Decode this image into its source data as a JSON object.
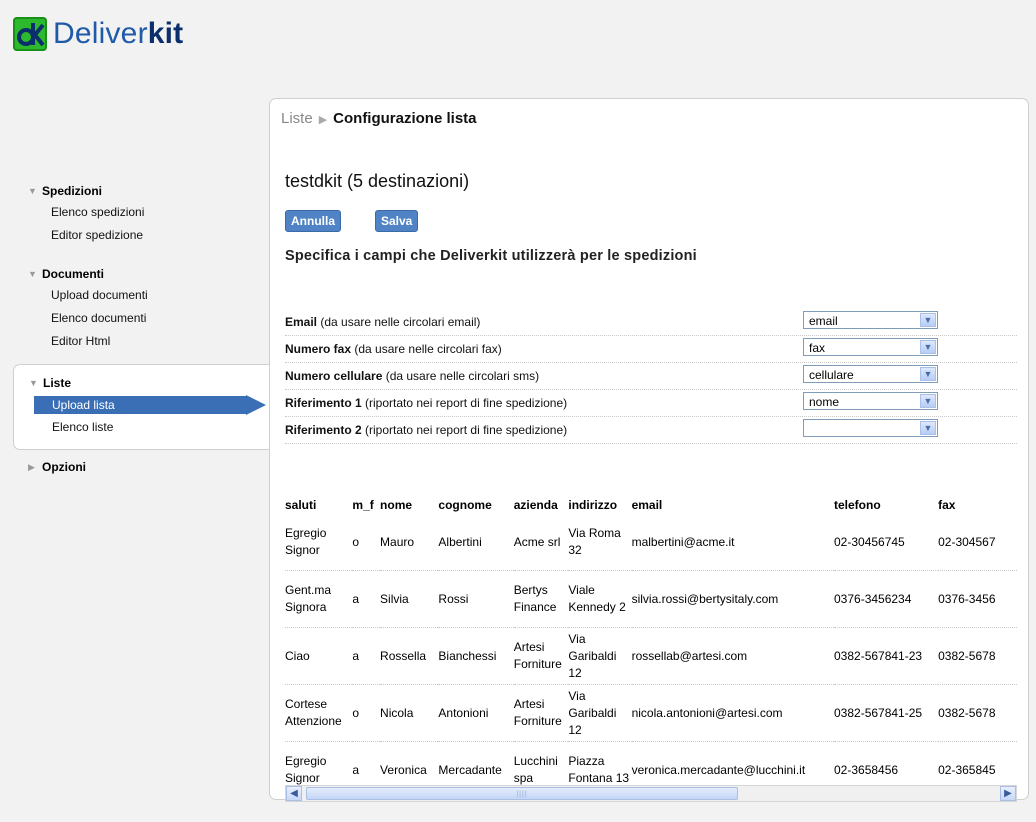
{
  "logo": {
    "text_light": "Deliver",
    "text_bold": "kit",
    "icon": "deliverkit-logo-icon",
    "color": "#2db92d"
  },
  "sidebar": {
    "sections": [
      {
        "title": "Spedizioni",
        "expanded": true,
        "items": [
          "Elenco spedizioni",
          "Editor spedizione"
        ]
      },
      {
        "title": "Documenti",
        "expanded": true,
        "items": [
          "Upload documenti",
          "Elenco documenti",
          "Editor Html"
        ]
      },
      {
        "title": "Liste",
        "expanded": true,
        "items": [
          "Upload lista",
          "Elenco liste"
        ],
        "active_item": "Upload lista"
      },
      {
        "title": "Opzioni",
        "expanded": false,
        "items": []
      }
    ]
  },
  "breadcrumb": {
    "parent": "Liste",
    "current": "Configurazione lista"
  },
  "main": {
    "list_title": "testdkit (5 destinazioni)",
    "buttons": {
      "cancel": "Annulla",
      "save": "Salva"
    },
    "subtitle": "Specifica i campi che Deliverkit utilizzerà per le spedizioni",
    "fields": [
      {
        "label": "Email",
        "hint": " (da usare nelle circolari email)",
        "value": "email"
      },
      {
        "label": "Numero fax",
        "hint": " (da usare nelle circolari fax)",
        "value": "fax"
      },
      {
        "label": "Numero cellulare",
        "hint": " (da usare nelle circolari sms)",
        "value": "cellulare"
      },
      {
        "label": "Riferimento 1",
        "hint": " (riportato nei report di fine spedizione)",
        "value": "nome"
      },
      {
        "label": "Riferimento 2",
        "hint": " (riportato nei report di fine spedizione)",
        "value": ""
      }
    ]
  },
  "table": {
    "columns": [
      "saluti",
      "m_f",
      "nome",
      "cognome",
      "azienda",
      "indirizzo",
      "email",
      "telefono",
      "fax"
    ],
    "rows": [
      [
        "Egregio Signor",
        "o",
        "Mauro",
        "Albertini",
        "Acme srl",
        "Via Roma 32",
        "malbertini@acme.it",
        "02-30456745",
        "02-304567"
      ],
      [
        "Gent.ma Signora",
        "a",
        "Silvia",
        "Rossi",
        "Bertys Finance",
        "Viale Kennedy 2",
        "silvia.rossi@bertysitaly.com",
        "0376-3456234",
        "0376-3456"
      ],
      [
        "Ciao",
        "a",
        "Rossella",
        "Bianchessi",
        "Artesi Forniture",
        "Via Garibaldi 12",
        "rossellab@artesi.com",
        "0382-567841-23",
        "0382-5678"
      ],
      [
        "Cortese Attenzione",
        "o",
        "Nicola",
        "Antonioni",
        "Artesi Forniture",
        "Via Garibaldi 12",
        "nicola.antonioni@artesi.com",
        "0382-567841-25",
        "0382-5678"
      ],
      [
        "Egregio Signor",
        "a",
        "Veronica",
        "Mercadante",
        "Lucchini spa",
        "Piazza Fontana 13",
        "veronica.mercadante@lucchini.it",
        "02-3658456",
        "02-365845"
      ]
    ]
  },
  "accent_color": "#4f83c5"
}
